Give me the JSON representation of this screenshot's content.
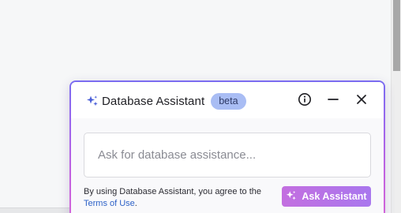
{
  "panel": {
    "title": "Database Assistant",
    "badge": "beta",
    "header_icons": [
      "sparkle-icon",
      "info-icon",
      "minimize-icon",
      "close-icon"
    ]
  },
  "prompt": {
    "value": "",
    "placeholder": "Ask for database assistance..."
  },
  "footer": {
    "disclaimer_text": "By using Database Assistant, you agree to the ",
    "terms_link": "Terms of Use",
    "period": ".",
    "ask_button_label": "Ask Assistant"
  },
  "colors": {
    "accent_gradient_start": "#7a6cf0",
    "accent_gradient_end": "#d566d8",
    "badge_bg": "#a9bdf4",
    "link": "#2f63c8",
    "button_start": "#c36fe0",
    "button_end": "#a977ee"
  }
}
